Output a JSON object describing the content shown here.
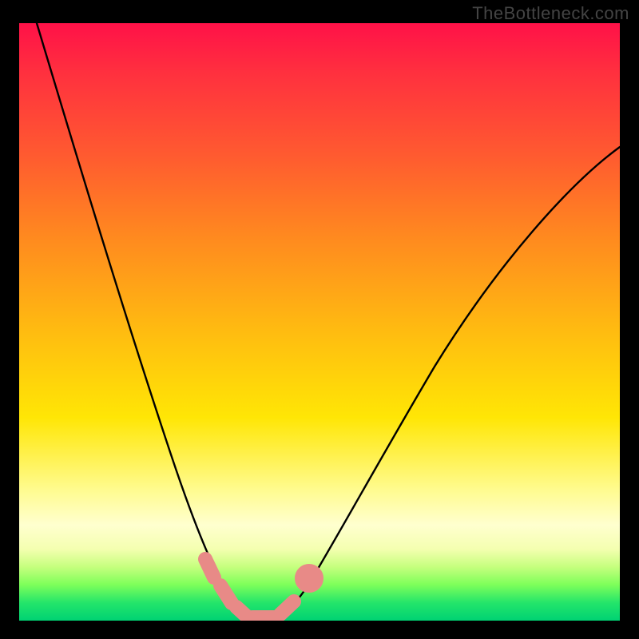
{
  "watermark": "TheBottleneck.com",
  "chart_data": {
    "type": "line",
    "title": "",
    "xlabel": "",
    "ylabel": "",
    "xlim": [
      0,
      100
    ],
    "ylim": [
      0,
      100
    ],
    "series": [
      {
        "name": "bottleneck-curve",
        "x": [
          3,
          6,
          9,
          12,
          15,
          18,
          21,
          24,
          27,
          30,
          32,
          34,
          35.5,
          37,
          40,
          44,
          50,
          58,
          68,
          80,
          92,
          100
        ],
        "values": [
          100,
          90,
          80.5,
          71,
          62,
          53,
          44.5,
          36,
          28,
          20,
          13,
          7,
          3,
          1,
          1,
          3,
          9,
          18,
          30,
          45,
          60,
          70
        ]
      }
    ],
    "annotations": [
      {
        "name": "marker-cluster",
        "x_range": [
          30,
          44
        ],
        "y_range": [
          0,
          10
        ]
      }
    ],
    "background": {
      "type": "gradient-vertical",
      "stops": [
        {
          "pos": 0.0,
          "color": "#ff1148"
        },
        {
          "pos": 0.22,
          "color": "#ff5a30"
        },
        {
          "pos": 0.52,
          "color": "#ffbd10"
        },
        {
          "pos": 0.78,
          "color": "#fffb8e"
        },
        {
          "pos": 0.94,
          "color": "#7dff5a"
        },
        {
          "pos": 1.0,
          "color": "#00d273"
        }
      ]
    }
  }
}
